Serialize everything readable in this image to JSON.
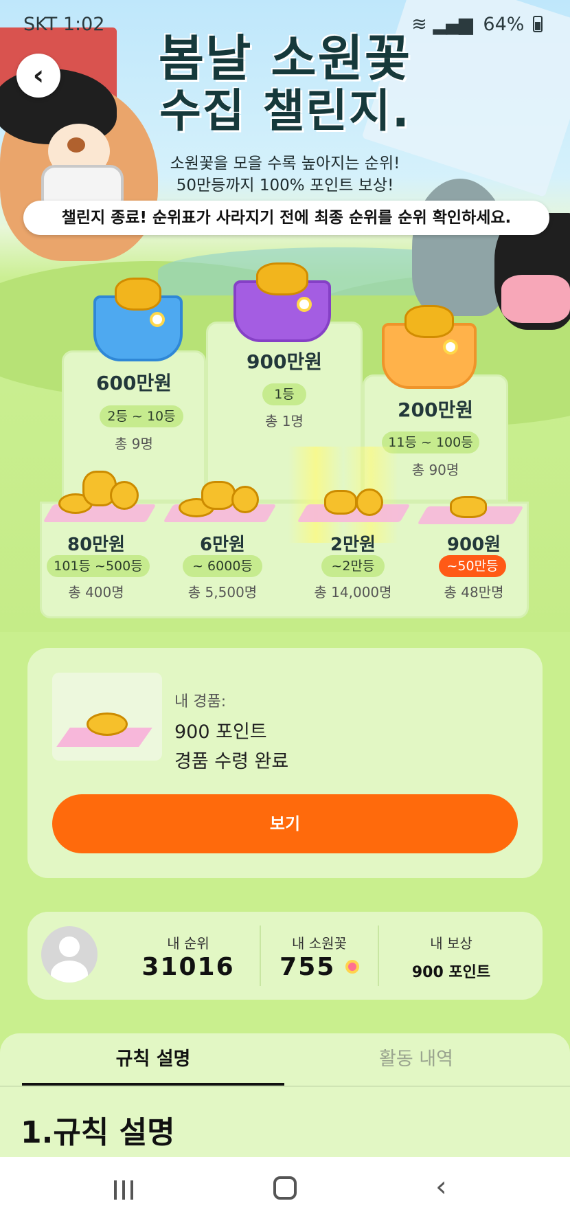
{
  "status": {
    "carrier_time": "SKT 1:02",
    "battery": "64%"
  },
  "header": {
    "title_line1": "봄날 소원꽃",
    "title_line2": "수집 챌린지.",
    "subtitle_line1": "소원꽃을 모을 수록 높아지는 순위!",
    "subtitle_line2": "50만등까지 100% 포인트 보상!",
    "notice": "챌린지 종료! 순위표가 사라지기 전에 최종 순위를 순위 확인하세요."
  },
  "podium": {
    "first": {
      "amount": "900만원",
      "rank": "1등",
      "count": "총 1명"
    },
    "second": {
      "amount": "600만원",
      "rank": "2등 ~ 10등",
      "count": "총 9명"
    },
    "third": {
      "amount": "200만원",
      "rank": "11등 ~ 100등",
      "count": "총 90명"
    }
  },
  "tiers": [
    {
      "amount": "80만원",
      "rank": "101등 ~500등",
      "count": "총 400명"
    },
    {
      "amount": "6만원",
      "rank": "~ 6000등",
      "count": "총 5,500명"
    },
    {
      "amount": "2만원",
      "rank": "~2만등",
      "count": "총 14,000명"
    },
    {
      "amount": "900원",
      "rank": "~50만등",
      "count": "총 48만명",
      "highlight": true
    }
  ],
  "my_prize": {
    "label": "내 경품:",
    "name": "900 포인트",
    "state": "경품 수령 완료",
    "button": "보기"
  },
  "stats": {
    "rank_label": "내 순위",
    "rank_value": "31016",
    "flower_label": "내 소원꽃",
    "flower_value": "755",
    "reward_label": "내 보상",
    "reward_value": "900 포인트"
  },
  "tabs": [
    {
      "label": "규칙 설명",
      "active": true
    },
    {
      "label": "활동 내역",
      "active": false
    }
  ],
  "section_title": "1.규칙 설명",
  "colors": {
    "accent": "#ff6a0c",
    "highlight_pill": "#ff5a16",
    "panel": "#e2f7c4",
    "background": "#c9ef8e"
  }
}
